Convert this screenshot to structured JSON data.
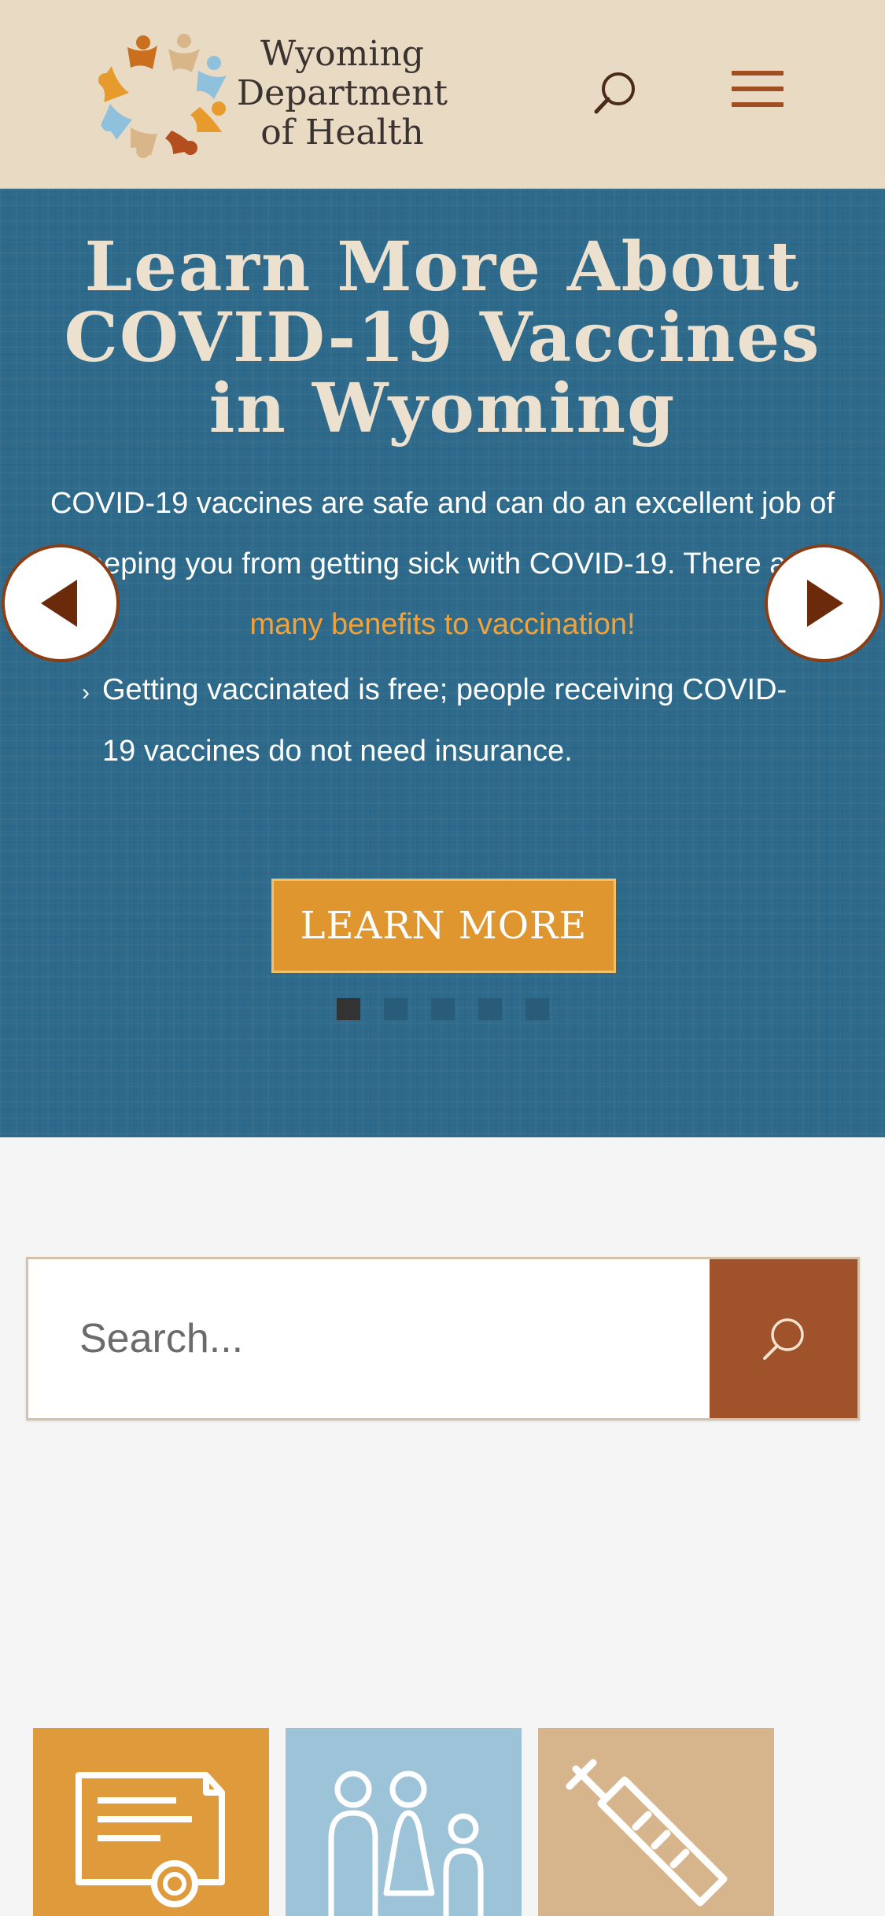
{
  "header": {
    "org_name_lines": [
      "Wyoming",
      "Department",
      "of Health"
    ],
    "logo_icon": "wdh-people-circle-logo",
    "search_icon": "search-icon",
    "menu_icon": "hamburger-menu-icon"
  },
  "hero": {
    "title": "Learn More About COVID-19 Vaccines in Wyoming",
    "body_text": "COVID-19 vaccines are safe and can do an excellent job of keeping you from getting sick with COVID-19. There are ",
    "body_link": "many benefits to vaccination!",
    "bullets": [
      "Getting vaccinated is free; people receiving COVID-19 vaccines do not need insurance."
    ],
    "button_label": "LEARN MORE",
    "slide_count": 5,
    "active_slide": 1,
    "prev_icon": "triangle-left-icon",
    "next_icon": "triangle-right-icon"
  },
  "search": {
    "placeholder": "Search...",
    "button_icon": "search-icon"
  },
  "tiles": [
    {
      "icon": "certificate-icon",
      "color": "#df9a3b"
    },
    {
      "icon": "family-icon",
      "color": "#9dc3d8"
    },
    {
      "icon": "syringe-icon",
      "color": "#d6b58d"
    }
  ],
  "colors": {
    "header_bg": "#e9dac4",
    "hero_bg": "#2d6a8c",
    "accent_orange": "#df962f",
    "accent_brown": "#a0522a",
    "link_orange": "#f0a23b"
  }
}
